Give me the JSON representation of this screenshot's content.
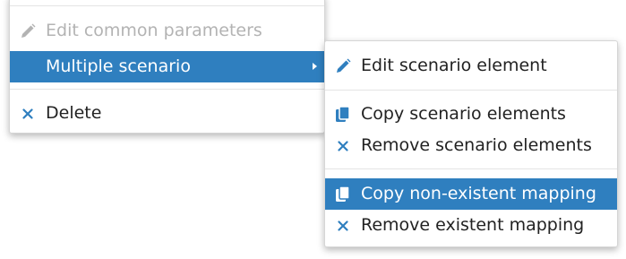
{
  "main_menu": {
    "items": [
      {
        "label": "Edit common parameters",
        "icon": "pencil-icon",
        "state": "disabled"
      },
      {
        "label": "Multiple scenario",
        "icon": "",
        "state": "active",
        "has_submenu": true
      },
      {
        "label": "Delete",
        "icon": "close-icon",
        "state": "normal"
      }
    ]
  },
  "sub_menu": {
    "items": [
      {
        "label": "Edit scenario element",
        "icon": "pencil-icon",
        "state": "normal"
      },
      {
        "label": "Copy scenario elements",
        "icon": "copy-icon",
        "state": "normal"
      },
      {
        "label": "Remove scenario elements",
        "icon": "close-icon",
        "state": "normal"
      },
      {
        "label": "Copy non-existent mapping",
        "icon": "copy-icon",
        "state": "active"
      },
      {
        "label": "Remove existent mapping",
        "icon": "close-icon",
        "state": "normal"
      }
    ]
  },
  "colors": {
    "accent": "#2f7fbf",
    "text": "#222222",
    "disabled_text": "#b3b3b3",
    "divider": "#e4e4e4"
  }
}
